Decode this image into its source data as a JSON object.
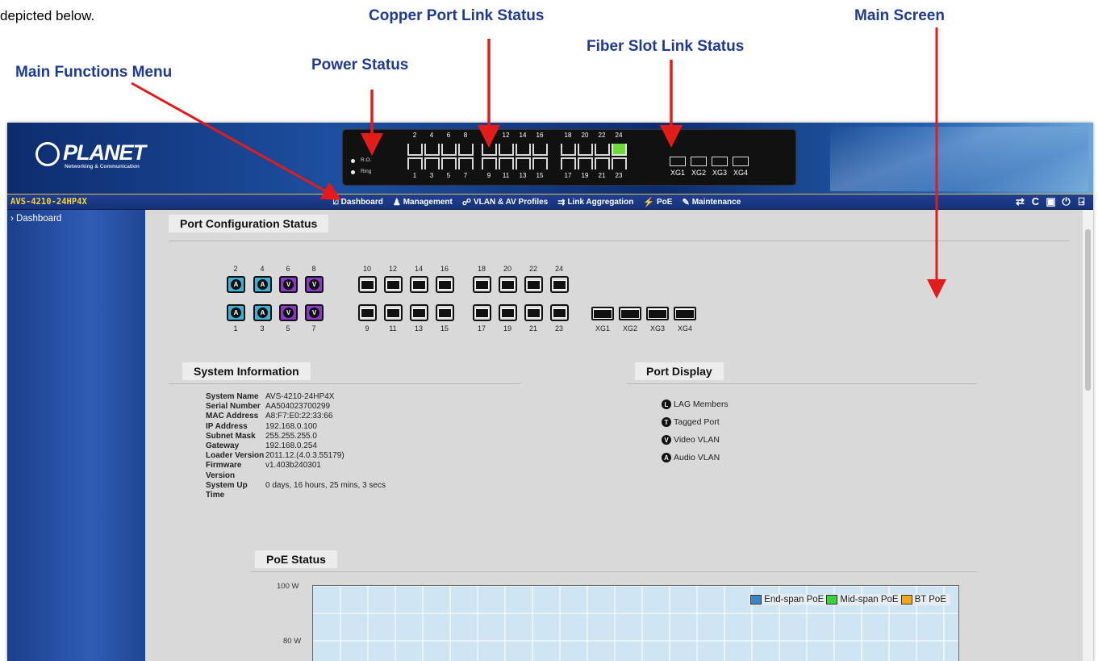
{
  "annotations": {
    "intro": "depicted below.",
    "menu": "Main Functions Menu",
    "power": "Power Status",
    "copper": "Copper Port Link Status",
    "fiber": "Fiber Slot Link Status",
    "main": "Main Screen"
  },
  "header": {
    "logo_text": "PLANET",
    "logo_sub": "Networking & Communication",
    "leds": [
      "R.O.",
      "Ring"
    ],
    "top_ports": [
      "2",
      "4",
      "6",
      "8",
      "10",
      "12",
      "14",
      "16",
      "18",
      "20",
      "22",
      "24"
    ],
    "bottom_ports": [
      "1",
      "3",
      "5",
      "7",
      "9",
      "11",
      "13",
      "15",
      "17",
      "19",
      "21",
      "23"
    ],
    "lit_port": "24",
    "fiber_ports": [
      "XG1",
      "XG2",
      "XG3",
      "XG4"
    ]
  },
  "menubar": {
    "model": "AVS-4210-24HP4X",
    "items": [
      {
        "label": "Dashboard",
        "icon": "chart-icon"
      },
      {
        "label": "Management",
        "icon": "users-icon"
      },
      {
        "label": "VLAN & AV Profiles",
        "icon": "network-icon"
      },
      {
        "label": "Link Aggregation",
        "icon": "aggregation-icon"
      },
      {
        "label": "PoE",
        "icon": "poe-icon"
      },
      {
        "label": "Maintenance",
        "icon": "wrench-icon"
      }
    ],
    "tools": [
      {
        "icon": "swap-icon",
        "glyph": "⇄"
      },
      {
        "icon": "refresh-icon",
        "glyph": "C"
      },
      {
        "icon": "save-icon",
        "glyph": "▣"
      },
      {
        "icon": "power-icon",
        "glyph": "⏻"
      },
      {
        "icon": "logout-icon",
        "glyph": "⍈"
      }
    ]
  },
  "sidebar": {
    "items": [
      {
        "label": "Dashboard"
      }
    ]
  },
  "port_config": {
    "title": "Port Configuration Status",
    "top_numbers": [
      "2",
      "4",
      "6",
      "8",
      "10",
      "12",
      "14",
      "16",
      "18",
      "20",
      "22",
      "24"
    ],
    "bottom_numbers": [
      "1",
      "3",
      "5",
      "7",
      "9",
      "11",
      "13",
      "15",
      "17",
      "19",
      "21",
      "23"
    ],
    "fiber_numbers": [
      "XG1",
      "XG2",
      "XG3",
      "XG4"
    ],
    "top_badges": [
      "A",
      "A",
      "V",
      "V"
    ],
    "bottom_badges": [
      "A",
      "A",
      "V",
      "V"
    ]
  },
  "system_info": {
    "title": "System Information",
    "rows": [
      {
        "k": "System Name",
        "v": "AVS-4210-24HP4X"
      },
      {
        "k": "Serial Number",
        "v": "AA504023700299"
      },
      {
        "k": "MAC Address",
        "v": "A8:F7:E0:22:33:66"
      },
      {
        "k": "IP Address",
        "v": "192.168.0.100"
      },
      {
        "k": "Subnet Mask",
        "v": "255.255.255.0"
      },
      {
        "k": "Gateway",
        "v": "192.168.0.254"
      },
      {
        "k": "Loader Version",
        "v": "2011.12.(4.0.3.55179)"
      },
      {
        "k": "Firmware Version",
        "v": "v1.403b240301"
      },
      {
        "k": "System Up Time",
        "v": "0 days, 16 hours, 25 mins, 3 secs"
      }
    ]
  },
  "port_display": {
    "title": "Port Display",
    "items": [
      {
        "badge": "L",
        "label": "LAG Members"
      },
      {
        "badge": "T",
        "label": "Tagged Port"
      },
      {
        "badge": "V",
        "label": "Video VLAN"
      },
      {
        "badge": "A",
        "label": "Audio VLAN"
      }
    ]
  },
  "poe_status": {
    "title": "PoE Status",
    "y_ticks": [
      "100 W",
      "80 W"
    ],
    "legend": [
      {
        "label": "End-span PoE",
        "color": "#3a86c9"
      },
      {
        "label": "Mid-span PoE",
        "color": "#3bd33b"
      },
      {
        "label": "BT PoE",
        "color": "#f0a818"
      }
    ]
  }
}
